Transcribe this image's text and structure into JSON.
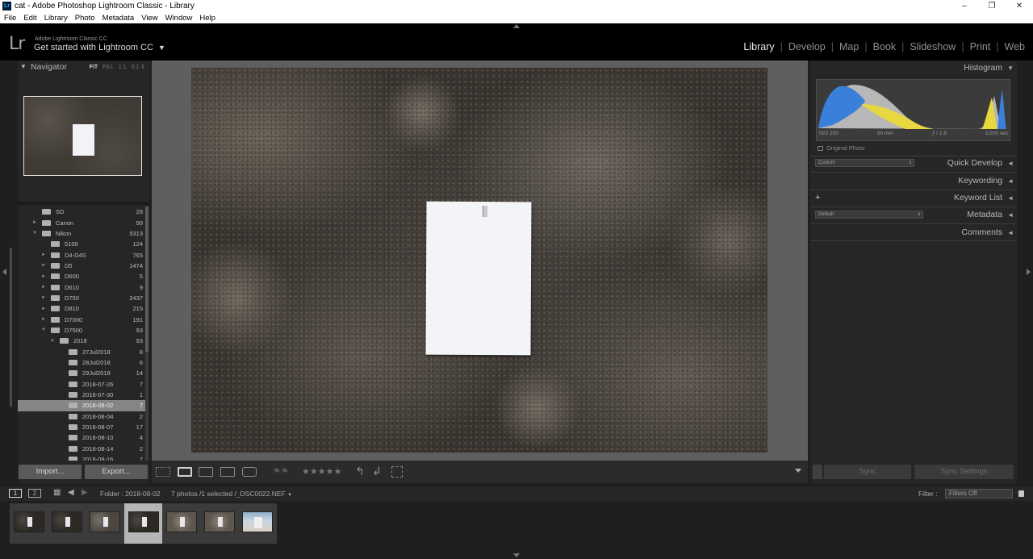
{
  "window": {
    "title": "cat - Adobe Photoshop Lightroom Classic - Library",
    "app_icon": "Lr",
    "controls": [
      "–",
      "❐",
      "✕"
    ]
  },
  "menu": [
    "File",
    "Edit",
    "Library",
    "Photo",
    "Metadata",
    "View",
    "Window",
    "Help"
  ],
  "identity": {
    "logo": "Lr",
    "subtitle": "Adobe Lightroom Classic CC",
    "tagline": "Get started with Lightroom CC",
    "caret": "▼"
  },
  "modules": [
    "Library",
    "Develop",
    "Map",
    "Book",
    "Slideshow",
    "Print",
    "Web"
  ],
  "active_module": "Library",
  "navigator": {
    "title": "Navigator",
    "zoom_options": [
      "FIT",
      "FILL",
      "1:1",
      "3:1"
    ],
    "active_zoom": "FIT"
  },
  "folders": [
    {
      "name": "SD",
      "count": "28",
      "level": 1,
      "expand": ""
    },
    {
      "name": "Canon",
      "count": "99",
      "level": 1,
      "expand": "►"
    },
    {
      "name": "Nikon",
      "count": "5313",
      "level": 1,
      "expand": "▼"
    },
    {
      "name": "5100",
      "count": "124",
      "level": 2,
      "expand": ""
    },
    {
      "name": "D4-D4S",
      "count": "765",
      "level": 2,
      "expand": "►"
    },
    {
      "name": "D5",
      "count": "1474",
      "level": 2,
      "expand": "►"
    },
    {
      "name": "D600",
      "count": "5",
      "level": 2,
      "expand": "►"
    },
    {
      "name": "D610",
      "count": "9",
      "level": 2,
      "expand": "►"
    },
    {
      "name": "D750",
      "count": "2437",
      "level": 2,
      "expand": "►"
    },
    {
      "name": "D810",
      "count": "215",
      "level": 2,
      "expand": "►"
    },
    {
      "name": "D7000",
      "count": "191",
      "level": 2,
      "expand": "►"
    },
    {
      "name": "D7500",
      "count": "93",
      "level": 2,
      "expand": "▼"
    },
    {
      "name": "2018",
      "count": "93",
      "level": 3,
      "expand": "▼"
    },
    {
      "name": "27Jul2018",
      "count": "8",
      "level": 4,
      "expand": ""
    },
    {
      "name": "28Jul2018",
      "count": "6",
      "level": 4,
      "expand": ""
    },
    {
      "name": "29Jul2018",
      "count": "14",
      "level": 4,
      "expand": ""
    },
    {
      "name": "2018-07-26",
      "count": "7",
      "level": 4,
      "expand": ""
    },
    {
      "name": "2018-07-30",
      "count": "1",
      "level": 4,
      "expand": ""
    },
    {
      "name": "2018-08-02",
      "count": "7",
      "level": 4,
      "expand": "►",
      "selected": true
    },
    {
      "name": "2018-08-04",
      "count": "2",
      "level": 4,
      "expand": ""
    },
    {
      "name": "2018-08-07",
      "count": "17",
      "level": 4,
      "expand": ""
    },
    {
      "name": "2018-08-10",
      "count": "4",
      "level": 4,
      "expand": ""
    },
    {
      "name": "2018-08-14",
      "count": "2",
      "level": 4,
      "expand": ""
    },
    {
      "name": "2018-08-16",
      "count": "7",
      "level": 4,
      "expand": ""
    }
  ],
  "left_buttons": {
    "import": "Import...",
    "export": "Export..."
  },
  "toolbar": {
    "stars": "★★★★★",
    "rotate_left": "↰",
    "rotate_right": "↲"
  },
  "histogram": {
    "title": "Histogram",
    "iso": "ISO 200",
    "focal": "50 mm",
    "aperture": "ƒ / 2.8",
    "shutter": "1/200 sec",
    "original_photo": "Original Photo",
    "colors": {
      "blue": "#3a7fd9",
      "yellow": "#e8d840",
      "gray": "#b7b7b7"
    }
  },
  "right_panels": {
    "quick_develop": "Quick Develop",
    "quick_develop_preset": "Custom",
    "keywording": "Keywording",
    "keyword_list": "Keyword List",
    "keyword_plus": "+",
    "metadata": "Metadata",
    "metadata_preset": "Default",
    "comments": "Comments"
  },
  "right_buttons": {
    "sync": "Sync",
    "sync_settings": "Sync Settings"
  },
  "filmstrip_bar": {
    "monitor1": "1",
    "monitor2": "2",
    "folder": "Folder : 2018-08-02",
    "info": "7 photos /1 selected /_DSC0022.NEF",
    "info_caret": "▼",
    "filter_label": "Filter :",
    "filter_value": "Filters Off"
  },
  "filmstrip": {
    "count": 7,
    "selected_index": 3
  }
}
